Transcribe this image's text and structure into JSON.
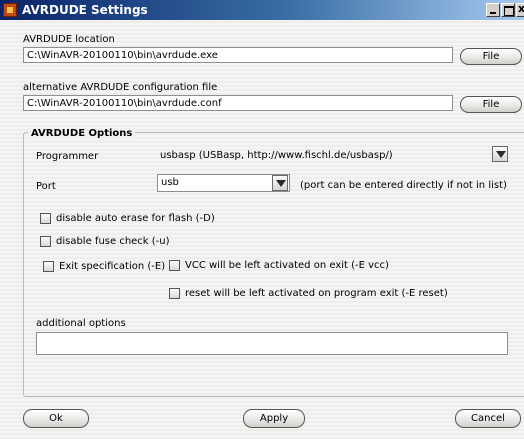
{
  "window": {
    "title": "AVRDUDE Settings",
    "close_glyph": "x"
  },
  "avrdude_location": {
    "label": "AVRDUDE location",
    "value": "C:\\WinAVR-20100110\\bin\\avrdude.exe",
    "file_button": "File"
  },
  "config_file": {
    "label": "alternative AVRDUDE configuration file",
    "value": "C:\\WinAVR-20100110\\bin\\avrdude.conf",
    "file_button": "File"
  },
  "options": {
    "group_title": "AVRDUDE Options",
    "programmer_label": "Programmer",
    "programmer_value": "usbasp (USBasp, http://www.fischl.de/usbasp/)",
    "port_label": "Port",
    "port_value": "usb",
    "port_hint": "(port can be entered directly if not in list)",
    "checkboxes": {
      "disable_erase": "disable auto erase for flash (-D)",
      "disable_fuse": "disable fuse check (-u)",
      "exit_spec": "Exit specification (-E)",
      "vcc": "VCC will be left activated on exit (-E vcc)",
      "reset": "reset will be left activated on program exit (-E reset)"
    },
    "checked": {
      "disable_erase": false,
      "disable_fuse": false,
      "exit_spec": false,
      "vcc": false,
      "reset": false
    },
    "additional_label": "additional options",
    "additional_value": ""
  },
  "buttons": {
    "ok": "Ok",
    "apply": "Apply",
    "cancel": "Cancel"
  },
  "icons": [
    "app-icon",
    "minimize-icon",
    "maximize-icon",
    "close-icon",
    "dropdown-arrow-icon"
  ]
}
